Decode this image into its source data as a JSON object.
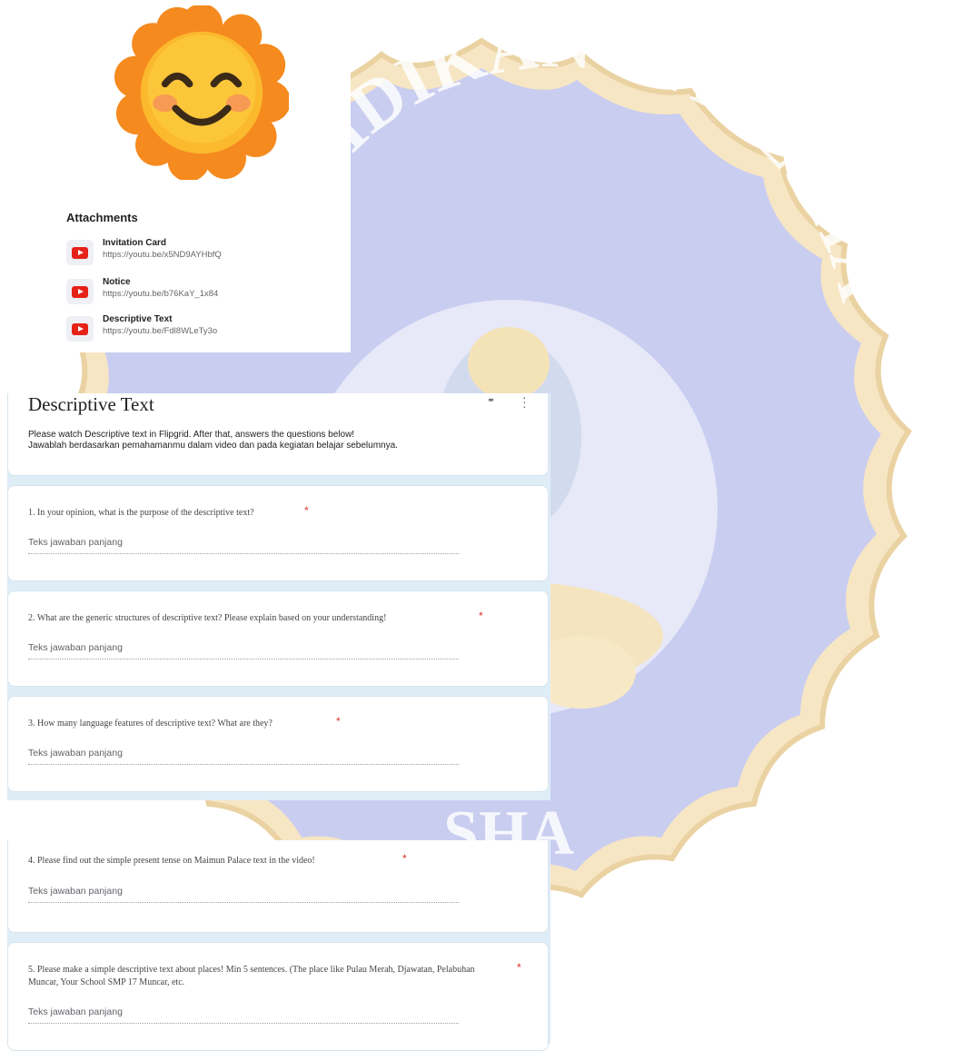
{
  "attachments": {
    "title": "Attachments",
    "items": [
      {
        "name": "Invitation Card",
        "url": "https://youtu.be/x5ND9AYHbfQ",
        "icon": "youtube-icon"
      },
      {
        "name": "Notice",
        "url": "https://youtu.be/b76KaY_1x84",
        "icon": "youtube-icon"
      },
      {
        "name": "Descriptive Text",
        "url": "https://youtu.be/Fdl8WLeTy3o",
        "icon": "youtube-icon"
      }
    ]
  },
  "watermark": {
    "text_top": "PENDIDIKAN GANESHA",
    "text_bottom": "SHA"
  },
  "section": {
    "title": "Descriptive Text",
    "description": "Please watch Descriptive text in Flipgrid. After that, answers the questions below!\nJawablah berdasarkan pemahamanmu dalam video dan pada kegiatan belajar sebelumnya.",
    "collapse_icon": "collapse-icon",
    "more_icon": "more-vert-icon"
  },
  "questions": [
    {
      "text": "1. In your opinion, what is the purpose of the descriptive text?",
      "required": "*",
      "placeholder": "Teks jawaban panjang"
    },
    {
      "text": "2.   What are the generic structures of descriptive text? Please explain based on your understanding!",
      "required": "*",
      "placeholder": "Teks jawaban panjang"
    },
    {
      "text": "3.   How many language features of descriptive text? What are they?",
      "required": "*",
      "placeholder": "Teks jawaban panjang"
    },
    {
      "text": "4.   Please find out the simple present tense on Maimun Palace text in the video!",
      "required": "*",
      "placeholder": "Teks jawaban panjang"
    },
    {
      "text": "5.   Please make a simple descriptive text about places! Min 5 sentences. (The place like Pulau Merah, Djawatan, Pelabuhan Muncar, Your School SMP 17 Muncar, etc.",
      "required": "*",
      "placeholder": "Teks jawaban panjang"
    }
  ],
  "colors": {
    "watermark_blue": "#c9cdf0",
    "watermark_gold": "#f6dfb4",
    "form_bg": "#dfedf7",
    "required_red": "#d93025",
    "youtube_red": "#e62117"
  }
}
